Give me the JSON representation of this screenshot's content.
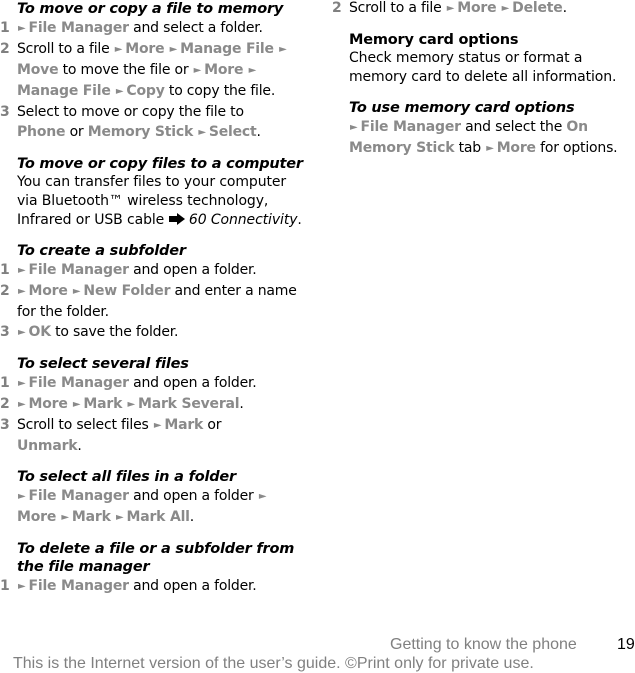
{
  "left": {
    "move_copy_memory": {
      "heading": "To move or copy a file to memory",
      "step1": {
        "num": "1",
        "m1": "File Manager",
        "t1": " and select a folder."
      },
      "step2": {
        "num": "2",
        "t0": "Scroll to a file ",
        "m1": "More",
        "m2": "Manage File",
        "m3": "Move",
        "t3": " to move the file or ",
        "m4": "More",
        "m5": "Manage File",
        "m6": "Copy",
        "t6": " to copy the file."
      },
      "step3": {
        "num": "3",
        "t0": "Select to move or copy the file to ",
        "m1": "Phone",
        "t1": " or ",
        "m2": "Memory Stick",
        "m3": "Select",
        "t3": "."
      }
    },
    "move_copy_computer": {
      "heading": "To move or copy files to a computer",
      "text": "You can transfer files to your computer via Bluetooth™ wireless technology, Infrared or USB cable ",
      "ref": "60 Connectivity",
      "end": "."
    },
    "create_subfolder": {
      "heading": "To create a subfolder",
      "step1": {
        "num": "1",
        "m1": "File Manager",
        "t1": " and open a folder."
      },
      "step2": {
        "num": "2",
        "m1": "More",
        "m2": "New Folder",
        "t2": " and enter a name for the folder."
      },
      "step3": {
        "num": "3",
        "m1": "OK",
        "t1": " to save the folder."
      }
    },
    "select_several": {
      "heading": "To select several files",
      "step1": {
        "num": "1",
        "m1": "File Manager",
        "t1": " and open a folder."
      },
      "step2": {
        "num": "2",
        "m1": "More",
        "m2": "Mark",
        "m3": "Mark Several",
        "t3": "."
      },
      "step3": {
        "num": "3",
        "t0": "Scroll to select files ",
        "m1": "Mark",
        "t1": " or ",
        "m2": "Unmark",
        "t2": "."
      }
    },
    "select_all": {
      "heading": "To select all files in a folder",
      "m1": "File Manager",
      "t1": " and open a folder ",
      "m2": "More",
      "m3": "Mark",
      "m4": "Mark All",
      "t4": "."
    },
    "delete": {
      "heading": "To delete a file or a subfolder from the file manager",
      "step1": {
        "num": "1",
        "m1": "File Manager",
        "t1": " and open a folder."
      }
    }
  },
  "right": {
    "delete_step2": {
      "num": "2",
      "t0": "Scroll to a file ",
      "m1": "More",
      "m2": "Delete",
      "t2": "."
    },
    "memory_card": {
      "heading": "Memory card options",
      "text": "Check memory status or format a memory card to delete all information."
    },
    "use_memory_card": {
      "heading": "To use memory card options",
      "m1": "File Manager",
      "t1": " and select the ",
      "m2": "On Memory Stick",
      "t2": " tab ",
      "m3": "More",
      "t3": " for options."
    }
  },
  "footer": {
    "section_title": "Getting to know the phone",
    "page_number": "19",
    "note": "This is the Internet version of the user’s guide. ©Print only for private use."
  },
  "icons": {
    "menu_arrow": "►"
  }
}
